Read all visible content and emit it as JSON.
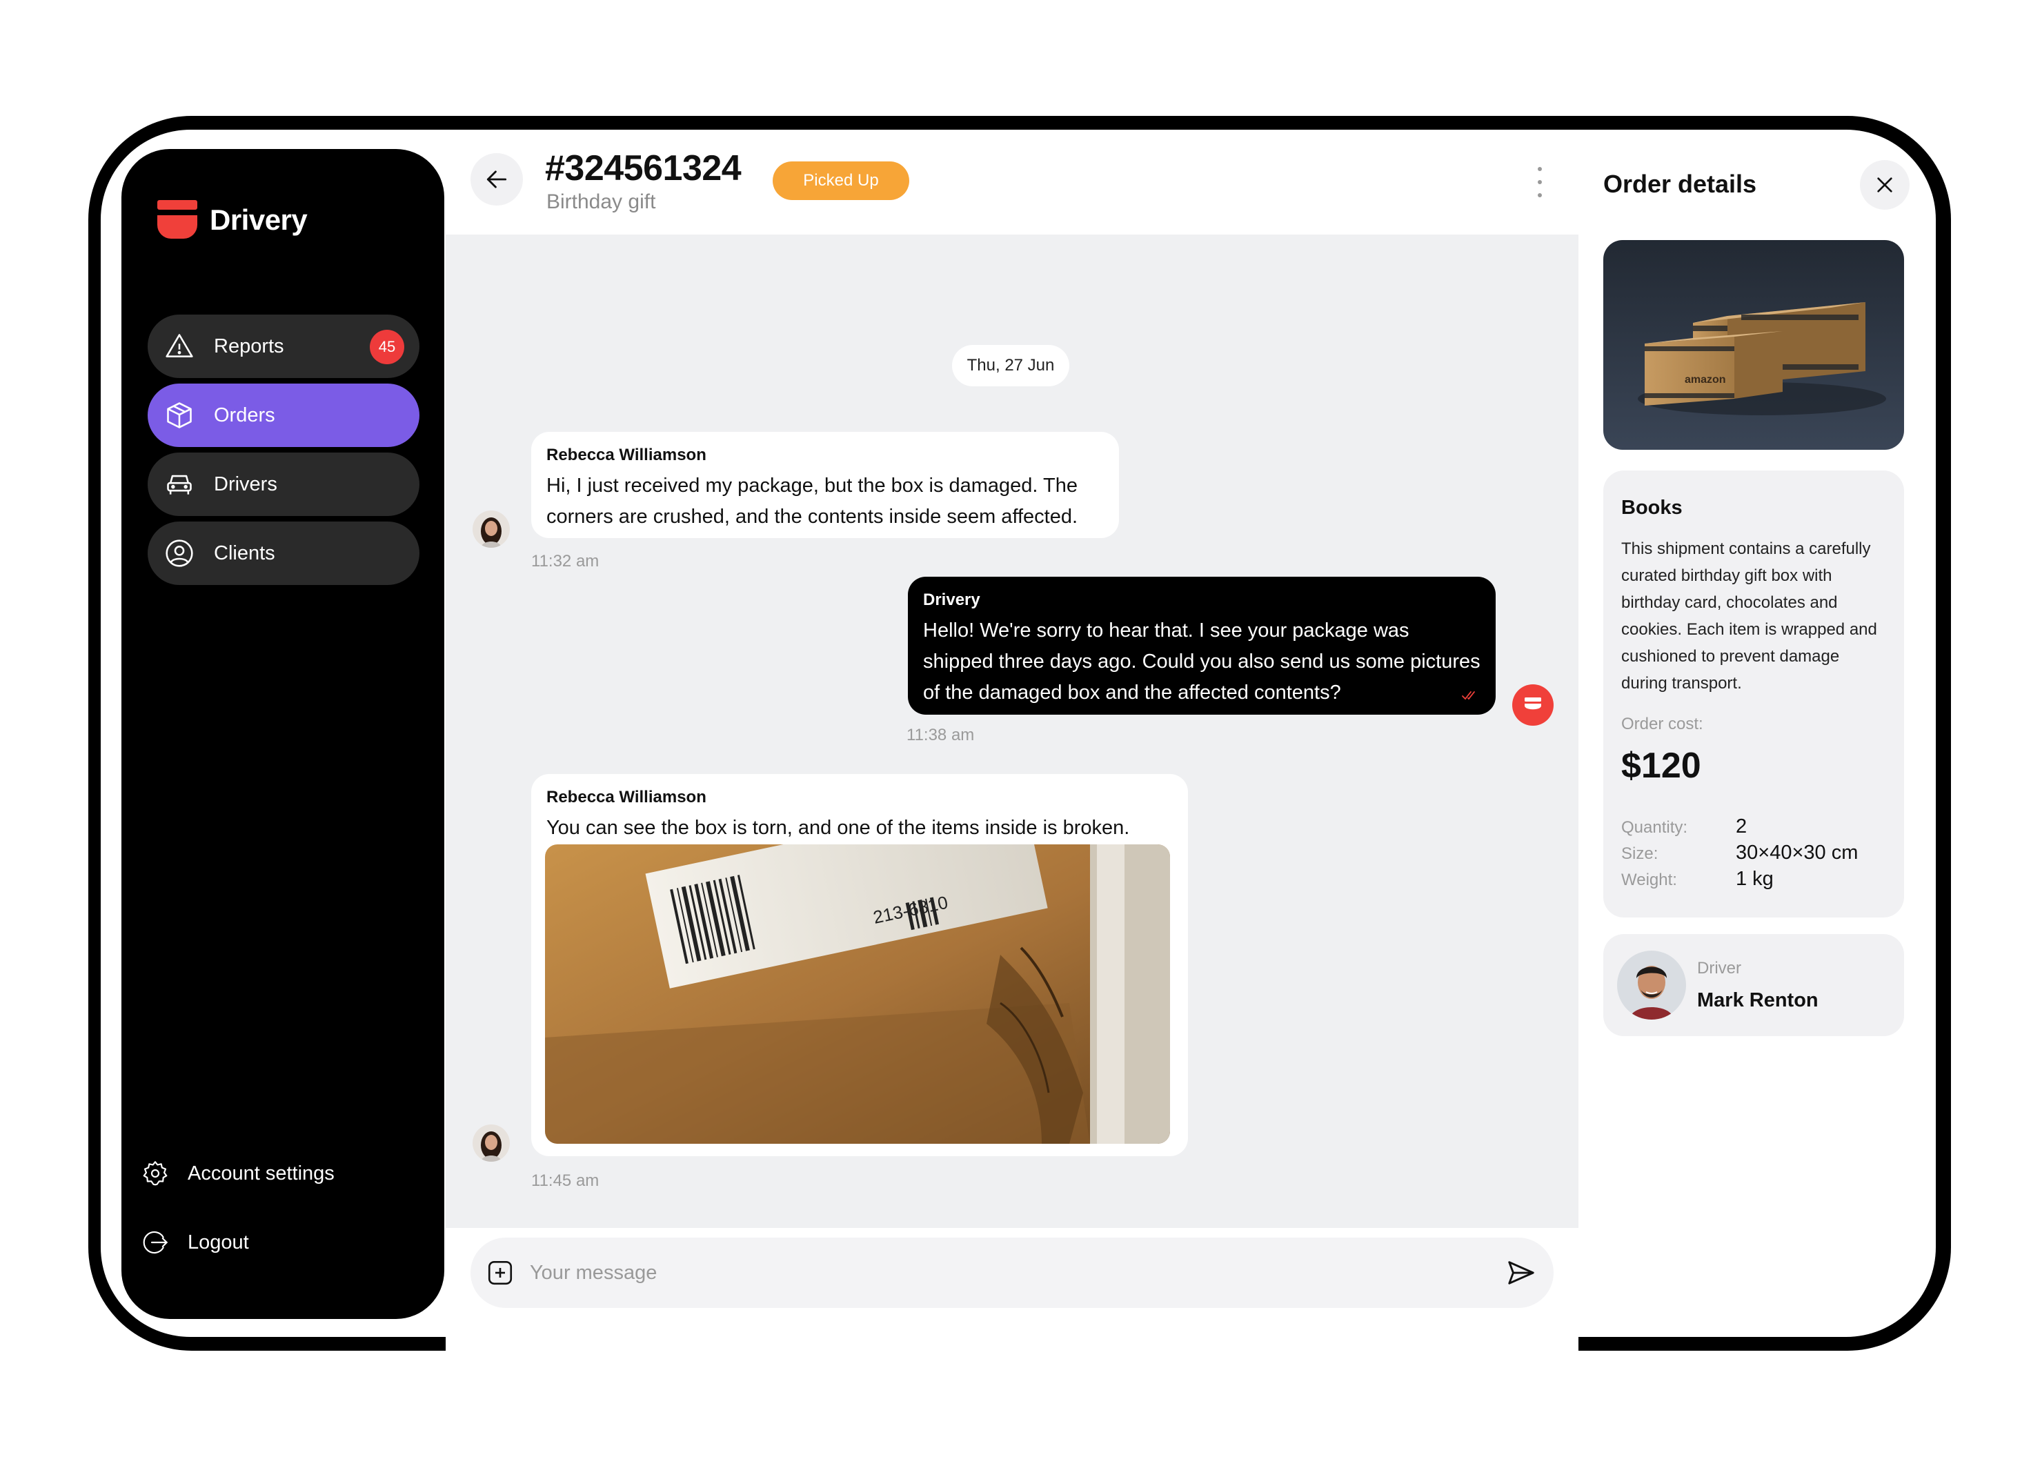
{
  "brand": {
    "name": "Drivery",
    "accent": "#f0403a",
    "nav_active_color": "#7b5ce6"
  },
  "sidebar": {
    "items": [
      {
        "label": "Reports",
        "icon": "warning-icon",
        "badge": "45"
      },
      {
        "label": "Orders",
        "icon": "box-icon",
        "active": true
      },
      {
        "label": "Drivers",
        "icon": "car-icon"
      },
      {
        "label": "Clients",
        "icon": "user-circle-icon"
      }
    ],
    "bottom": [
      {
        "label": "Account settings",
        "icon": "gear-icon"
      },
      {
        "label": "Logout",
        "icon": "logout-icon"
      }
    ]
  },
  "header": {
    "order_id": "#324561324",
    "subtitle": "Birthday gift",
    "status": "Picked Up",
    "status_color": "#f7a537"
  },
  "chat": {
    "date": "Thu, 27 Jun",
    "messages": [
      {
        "sender": "Rebecca Williamson",
        "text": "Hi, I just received my package, but the box is damaged. The corners are crushed, and the contents inside seem affected.",
        "time": "11:32 am",
        "direction": "in"
      },
      {
        "sender": "Drivery",
        "text": "Hello! We're sorry to hear that. I see your package was shipped three days ago. Could you also send us some pictures of the damaged box and the affected contents?",
        "time": "11:38 am",
        "direction": "out",
        "status_icon": "double-check-icon"
      },
      {
        "sender": "Rebecca Williamson",
        "text": "You can see the box is torn, and one of the items inside is broken.",
        "time": "11:45 am",
        "direction": "in",
        "attachment_label_digits": "213-6810"
      }
    ]
  },
  "composer": {
    "placeholder": "Your message"
  },
  "details": {
    "title": "Order details",
    "category": "Books",
    "description": "This shipment contains a carefully curated birthday gift box with birthday card, chocolates and cookies. Each item is wrapped and cushioned to prevent damage during transport.",
    "cost_label": "Order cost:",
    "cost": "$120",
    "specs": [
      {
        "label": "Quantity:",
        "value": "2"
      },
      {
        "label": "Size:",
        "value": "30×40×30 cm"
      },
      {
        "label": "Weight:",
        "value": "1 kg"
      }
    ],
    "driver_label": "Driver",
    "driver_name": "Mark Renton",
    "product_box_text": "amazon"
  }
}
